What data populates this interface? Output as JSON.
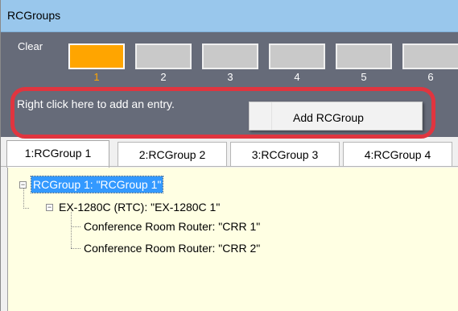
{
  "window": {
    "title": "RCGroups"
  },
  "slots": {
    "clear_label": "Clear",
    "items": [
      {
        "number": "1",
        "active": true
      },
      {
        "number": "2",
        "active": false
      },
      {
        "number": "3",
        "active": false
      },
      {
        "number": "4",
        "active": false
      },
      {
        "number": "5",
        "active": false
      },
      {
        "number": "6",
        "active": false
      }
    ]
  },
  "hint": "Right click here to add an entry.",
  "context_menu": {
    "item": "Add RCGroup"
  },
  "tabs": [
    {
      "label": "1:RCGroup 1",
      "active": true
    },
    {
      "label": "2:RCGroup 2",
      "active": false
    },
    {
      "label": "3:RCGroup 3",
      "active": false
    },
    {
      "label": "4:RCGroup 4",
      "active": false
    }
  ],
  "tree": {
    "root": "RCGroup 1: \"RCGroup 1\"",
    "child": "EX-1280C (RTC): \"EX-1280C 1\"",
    "leaves": [
      "Conference Room Router: \"CRR 1\"",
      "Conference Room Router: \"CRR 2\""
    ],
    "expander_symbol": "−"
  },
  "colors": {
    "titlebar": "#99c7ec",
    "panel": "#666b79",
    "active_slot": "#ffa500",
    "highlight_ring": "#e0353f",
    "tree_background": "#ffffe3",
    "selection": "#3399ff"
  }
}
